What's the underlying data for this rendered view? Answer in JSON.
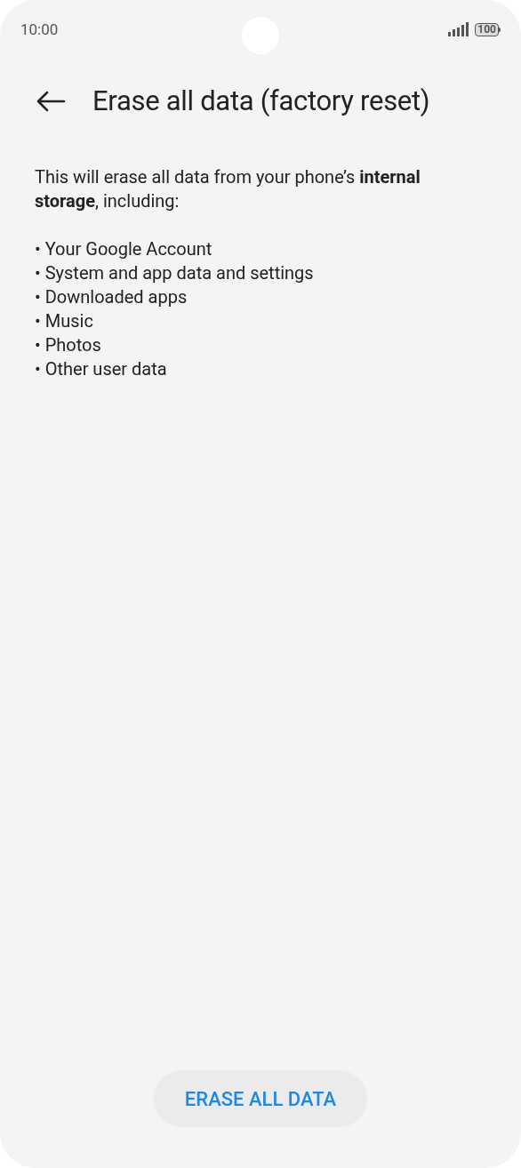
{
  "status_bar": {
    "time": "10:00",
    "battery": "100"
  },
  "header": {
    "title": "Erase all data (factory reset)"
  },
  "intro": "This will erase all data from your phone’s **internal storage**, including:",
  "items": [
    {
      "text": "• Your Google Account"
    },
    {
      "text": "• System and app data and settings"
    },
    {
      "text": "• Downloaded apps"
    },
    {
      "text": "• Music"
    },
    {
      "text": "• Photos"
    },
    {
      "text": "• Other user data"
    }
  ],
  "button": {
    "label": "ERASE ALL DATA"
  }
}
